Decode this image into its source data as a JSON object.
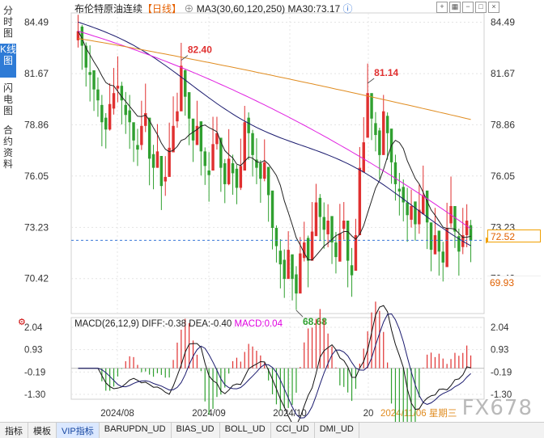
{
  "side_tabs": [
    {
      "label": "分时图",
      "active": false
    },
    {
      "label": "K线图",
      "active": true
    },
    {
      "label": "闪电图",
      "active": false
    },
    {
      "label": "合约资料",
      "active": false
    }
  ],
  "header": {
    "title": "布伦特原油连续",
    "period": "【日线】",
    "ma_label": "MA3(30,60,120,250)",
    "ma30_label": "MA30:73.17"
  },
  "toolbar_icons": [
    "add-icon",
    "grid-icon",
    "minus-icon",
    "square-icon",
    "close-icon"
  ],
  "price_axis": {
    "ticks": [
      "84.49",
      "81.67",
      "78.86",
      "76.05",
      "73.23",
      "70.42"
    ]
  },
  "current_price": "72.52",
  "ma250_value": "69.93",
  "annotations": {
    "high1": "82.40",
    "high2": "81.14",
    "low1": "68.68"
  },
  "macd": {
    "header": "MACD(26,12,9)",
    "diff": "DIFF:-0.38",
    "dea": "DEA:-0.40",
    "macd": "MACD:0.04",
    "ticks": [
      "2.04",
      "0.93",
      "-0.19",
      "-1.30"
    ]
  },
  "x_axis": {
    "labels": [
      "2024/08",
      "2024/09",
      "2024/10",
      "20"
    ],
    "cursor_date": "2024/11/06 星期三"
  },
  "bottom_tabs": [
    {
      "label": "指标",
      "active": false
    },
    {
      "label": "模板",
      "active": false
    },
    {
      "label": "VIP指标",
      "active": true
    },
    {
      "label": "BARUPDN_UD",
      "active": false
    },
    {
      "label": "BIAS_UD",
      "active": false
    },
    {
      "label": "BOLL_UD",
      "active": false
    },
    {
      "label": "CCI_UD",
      "active": false
    },
    {
      "label": "DMI_UD",
      "active": false
    }
  ],
  "watermark": "FX678",
  "colors": {
    "up": "#e03030",
    "down": "#30a030",
    "ma30": "#222222",
    "ma60": "#1a1a6e",
    "ma120": "#e020e0",
    "ma250": "#e08c20",
    "accent": "#e06000",
    "grid": "#e4e4e4"
  },
  "chart_data": {
    "type": "candlestick",
    "title": "布伦特原油连续 日线",
    "ylim": [
      68.5,
      85.0
    ],
    "x_labels": [
      "2024/08",
      "2024/09",
      "2024/10",
      "2024/11"
    ],
    "series": [
      {
        "name": "MA30",
        "value": 73.17
      },
      {
        "name": "MA60"
      },
      {
        "name": "MA120"
      },
      {
        "name": "MA250"
      }
    ],
    "annotated_points": [
      {
        "label": "high",
        "value": 82.4
      },
      {
        "label": "high",
        "value": 81.14
      },
      {
        "label": "low",
        "value": 68.68
      }
    ],
    "current_price": 72.52,
    "macd": {
      "diff": -0.38,
      "dea": -0.4,
      "macd": 0.04,
      "ylim": [
        -1.3,
        2.04
      ]
    }
  }
}
